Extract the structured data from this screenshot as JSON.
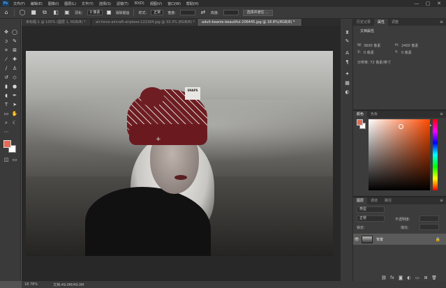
{
  "app": {
    "logo": "Ps"
  },
  "menubar": {
    "items": [
      "文件(F)",
      "编辑(E)",
      "图像(I)",
      "图层(L)",
      "文字(Y)",
      "选择(S)",
      "滤镜(T)",
      "3D(D)",
      "视图(V)",
      "窗口(W)",
      "帮助(H)"
    ],
    "window_controls": [
      "—",
      "▢",
      "✕"
    ]
  },
  "options_bar": {
    "feather_label": "羽化:",
    "feather_value": "0 像素",
    "antialias_label": "消除锯齿",
    "style_label": "样式:",
    "style_value": "正常",
    "width_label": "宽度:",
    "height_label": "高度:",
    "select_mask_button": "选择并遮住 ..."
  },
  "tabs": [
    {
      "label": "未标题-1 @ 100% (图层 1, RGB/8) *",
      "active": false
    },
    {
      "label": "air-force-aircraft-airplane-122164.jpg @ 33.3% (RGB/8) *",
      "active": false
    },
    {
      "label": "adult-beanie-beautiful-206445.jpg @ 18.8%(RGB/8) *",
      "active": true
    }
  ],
  "photo": {
    "hat_label": "SNAPS"
  },
  "status": {
    "zoom": "18.78%",
    "doc_info": "文档:49.0M/49.0M"
  },
  "properties_panel": {
    "tabs": [
      "历史记录",
      "属性",
      "调整"
    ],
    "title": "文档属性",
    "w_label": "W:",
    "w_value": "3600 像素",
    "h_label": "H:",
    "h_value": "2400 像素",
    "x_label": "X:",
    "x_value": "0 像素",
    "y_label": "Y:",
    "y_value": "0 像素",
    "resolution": "分辨率: 72 像素/英寸"
  },
  "color_panel": {
    "tabs": [
      "颜色",
      "色板"
    ],
    "foreground_color": "#e06c55",
    "background_color": "#ffffff"
  },
  "layers_panel": {
    "tabs": [
      "图层",
      "通道",
      "路径"
    ],
    "kind_label": "类型",
    "blend_mode": "正常",
    "opacity_label": "不透明度:",
    "lock_label": "锁定:",
    "fill_label": "填充:",
    "layers": [
      {
        "name": "背景",
        "visible": true,
        "locked": true
      }
    ]
  }
}
